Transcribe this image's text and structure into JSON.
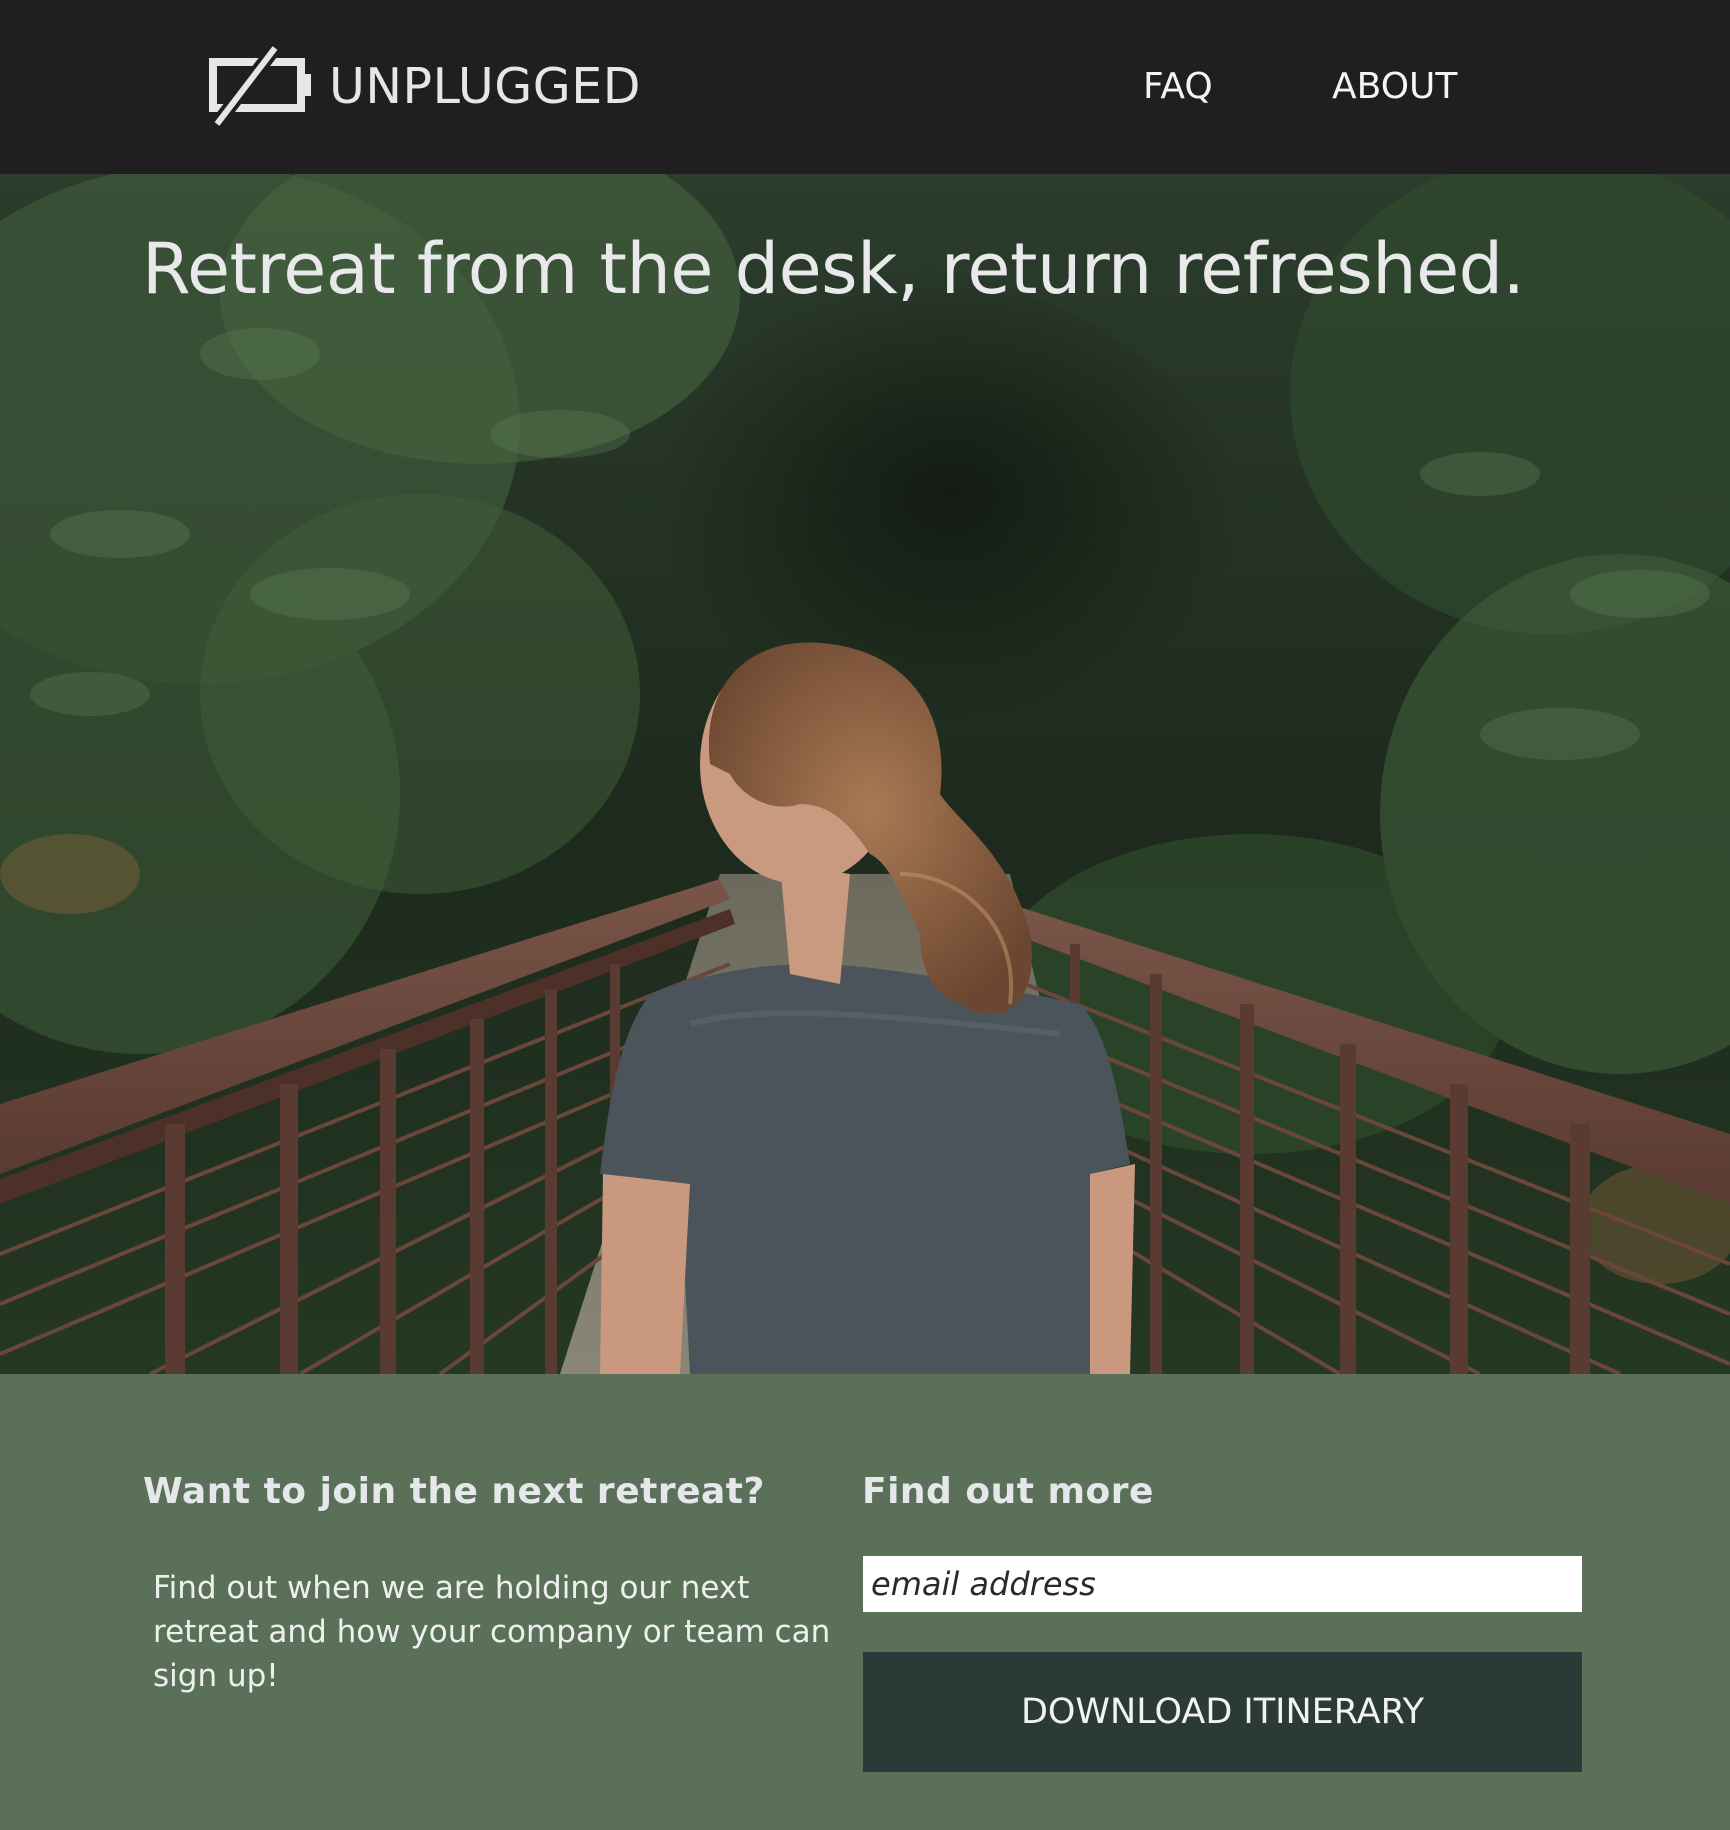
{
  "header": {
    "logo_text": "UNPLUGGED",
    "logo_icon": "unplugged-battery-icon",
    "nav": [
      {
        "label": "FAQ"
      },
      {
        "label": "ABOUT"
      }
    ]
  },
  "hero": {
    "title": "Retreat from the desk, return refreshed."
  },
  "signup": {
    "join_heading": "Want to join the next retreat?",
    "join_text": "Find out when we are holding our next retreat and how your company or team can sign up!",
    "more_heading": "Find out more",
    "email_placeholder": "email address",
    "email_value": "",
    "download_label": "DOWNLOAD ITINERARY"
  },
  "colors": {
    "header_bg": "#1f1f1f",
    "section_bg": "#5a7058",
    "button_bg": "#2b3a36",
    "input_bg": "#ffffff"
  }
}
